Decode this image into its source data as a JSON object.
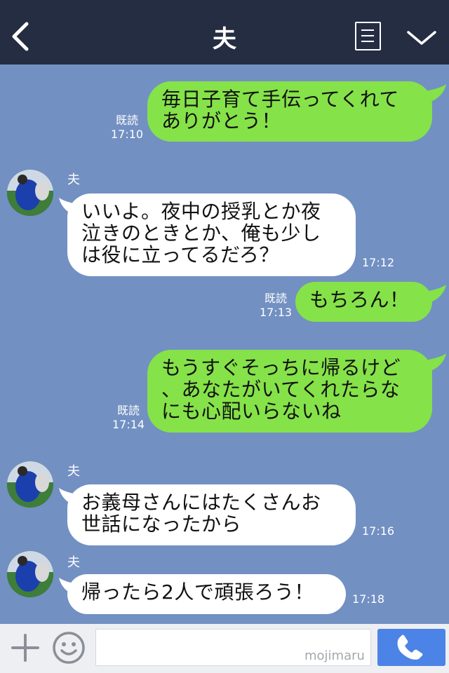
{
  "header": {
    "title": "夫",
    "bg_color": "#242d42"
  },
  "chat": {
    "bg_color": "#7290c2",
    "sent_bubble_color": "#85e249",
    "received_bubble_color": "#ffffff",
    "messages": [
      {
        "from": "me",
        "text": "毎日子育て手伝ってくれて\nありがとう！",
        "read": "既読",
        "time": "17:10"
      },
      {
        "from": "夫",
        "text": "いいよ。夜中の授乳とか夜\n泣きのときとか、俺も少し\nは役に立ってるだろ？",
        "time": "17:12"
      },
      {
        "from": "me",
        "text": "もちろん！",
        "read": "既読",
        "time": "17:13"
      },
      {
        "from": "me",
        "text": "もうすぐそっちに帰るけど\n、あなたがいてくれたらな\nにも心配いらないね",
        "read": "既読",
        "time": "17:14"
      },
      {
        "from": "夫",
        "text": "お義母さんにはたくさんお\n世話になったから",
        "time": "17:16"
      },
      {
        "from": "夫",
        "text": "帰ったら2人で頑張ろう！",
        "time": "17:18"
      }
    ]
  },
  "input_bar": {
    "message_value": "",
    "watermark": "mojimaru",
    "call_button_color": "#4b83e6"
  },
  "icons": [
    "back-icon",
    "menu-icon",
    "chevron-down-icon",
    "plus-icon",
    "emoji-icon",
    "phone-icon"
  ]
}
